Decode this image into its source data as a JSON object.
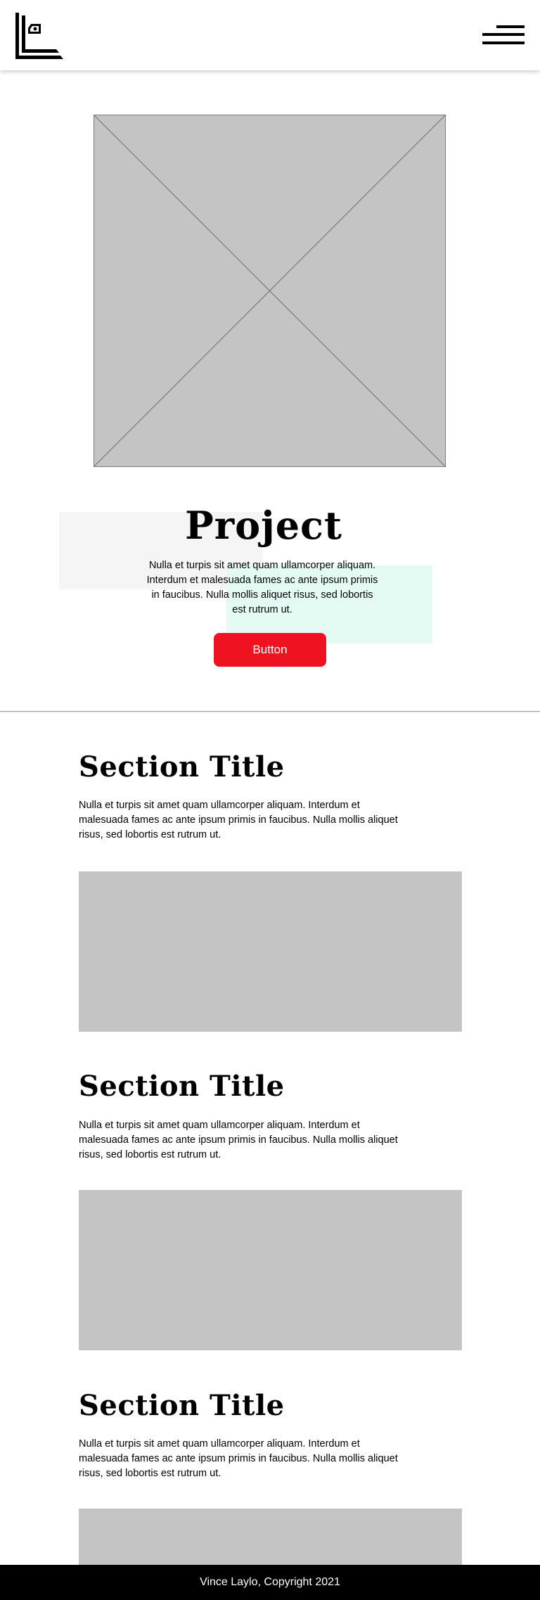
{
  "header": {
    "logo_icon": "logo-mark-icon",
    "menu_icon": "hamburger-menu-icon"
  },
  "hero": {
    "image_icon": "image-placeholder-icon",
    "title": "Project",
    "description": "Nulla et turpis sit amet quam ullamcorper aliquam. Interdum et malesuada fames ac ante ipsum primis in faucibus. Nulla mollis aliquet risus, sed lobortis est rutrum ut.",
    "button_label": "Button",
    "button_color": "#ef1221",
    "accent_grey": "#f5f5f5",
    "accent_mint": "#e3fbf3"
  },
  "sections": [
    {
      "title": "Section Title",
      "description": "Nulla et turpis sit amet quam ullamcorper aliquam. Interdum et malesuada fames ac ante ipsum primis in faucibus. Nulla mollis aliquet risus, sed lobortis est rutrum ut."
    },
    {
      "title": "Section Title",
      "description": "Nulla et turpis sit amet quam ullamcorper aliquam. Interdum et malesuada fames ac ante ipsum primis in faucibus. Nulla mollis aliquet risus, sed lobortis est rutrum ut."
    },
    {
      "title": "Section Title",
      "description": "Nulla et turpis sit amet quam ullamcorper aliquam. Interdum et malesuada fames ac ante ipsum primis in faucibus. Nulla mollis aliquet risus, sed lobortis est rutrum ut."
    }
  ],
  "placeholder_color": "#c4c4c4",
  "footer": {
    "text": "Vince Laylo, Copyright 2021"
  }
}
